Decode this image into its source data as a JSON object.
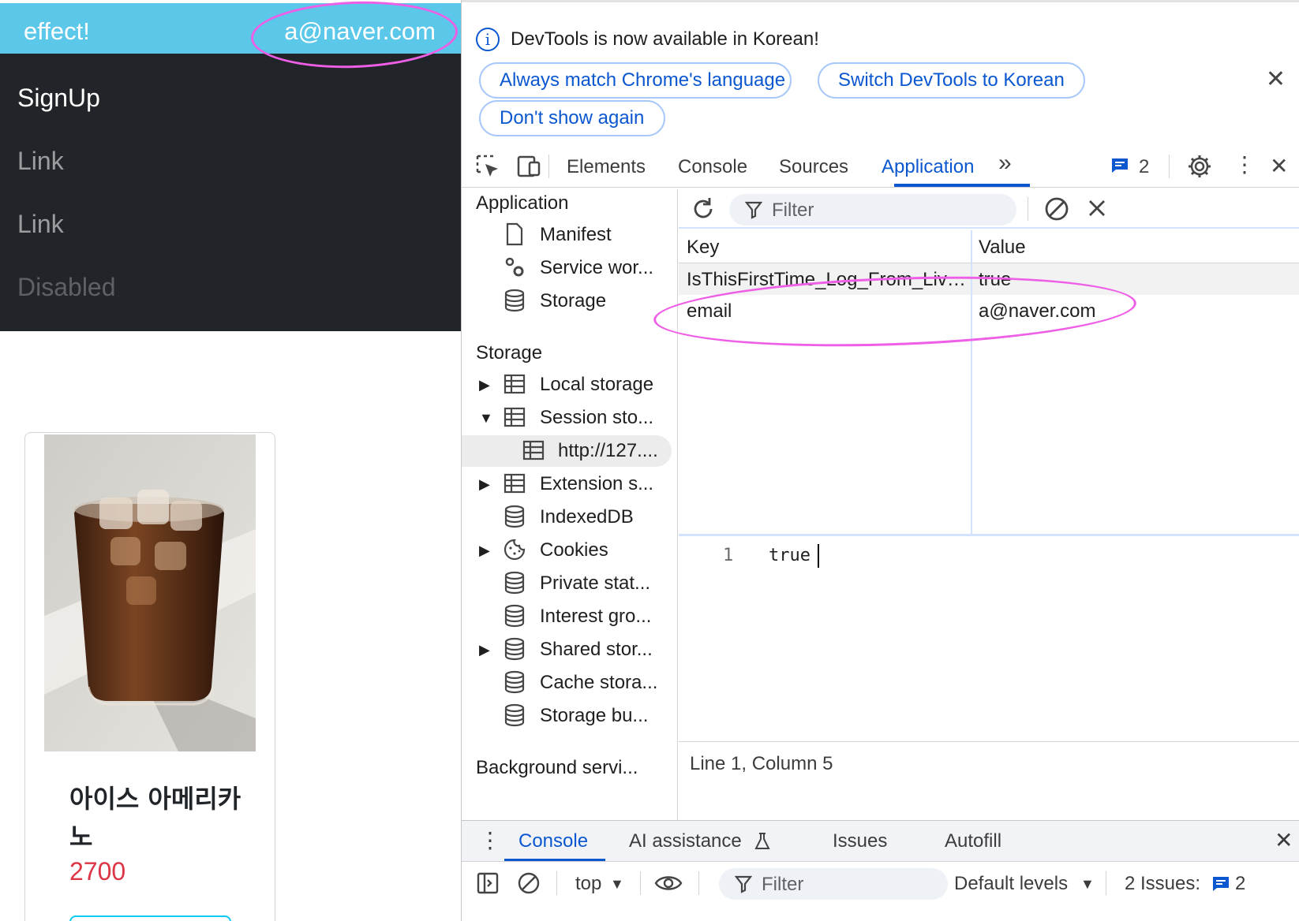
{
  "website": {
    "brand": "effect!",
    "user_email": "a@naver.com",
    "nav": {
      "signup": "SignUp",
      "link1": "Link",
      "link2": "Link",
      "disabled": "Disabled"
    },
    "product": {
      "name": "아이스 아메리카노",
      "price": "2700"
    }
  },
  "devtools": {
    "infobar": {
      "message": "DevTools is now available in Korean!",
      "btn_match": "Always match Chrome's language",
      "btn_switch": "Switch DevTools to Korean",
      "btn_dont_show": "Don't show again"
    },
    "tabs": {
      "elements": "Elements",
      "console": "Console",
      "sources": "Sources",
      "application": "Application",
      "issues_count": "2"
    },
    "sidebar": {
      "application_heading": "Application",
      "storage_heading": "Storage",
      "background_heading": "Background servi...",
      "items": [
        {
          "label": "Manifest",
          "icon": "document-icon"
        },
        {
          "label": "Service wor...",
          "icon": "gears-icon"
        },
        {
          "label": "Storage",
          "icon": "database-icon"
        },
        {
          "label": "Local storage",
          "icon": "table-icon"
        },
        {
          "label": "Session sto...",
          "icon": "table-icon"
        },
        {
          "label": "http://127....",
          "icon": "table-icon"
        },
        {
          "label": "Extension s...",
          "icon": "table-icon"
        },
        {
          "label": "IndexedDB",
          "icon": "database-icon"
        },
        {
          "label": "Cookies",
          "icon": "cookie-icon"
        },
        {
          "label": "Private stat...",
          "icon": "database-icon"
        },
        {
          "label": "Interest gro...",
          "icon": "database-icon"
        },
        {
          "label": "Shared stor...",
          "icon": "database-icon"
        },
        {
          "label": "Cache stora...",
          "icon": "database-icon"
        },
        {
          "label": "Storage bu...",
          "icon": "database-icon"
        }
      ]
    },
    "storage_view": {
      "filter_placeholder": "Filter",
      "columns": {
        "key": "Key",
        "value": "Value"
      },
      "rows": [
        {
          "key": "IsThisFirstTime_Log_From_LiveServer",
          "value": "true"
        },
        {
          "key": "email",
          "value": "a@naver.com"
        }
      ],
      "editor": {
        "line_number": "1",
        "line_text": "true"
      },
      "status": "Line 1, Column 5"
    },
    "drawer": {
      "tabs": {
        "console": "Console",
        "ai_assistance": "AI assistance",
        "issues": "Issues",
        "autofill": "Autofill"
      },
      "context": "top",
      "filter_placeholder": "Filter",
      "levels": "Default levels",
      "issues_label": "2 Issues:",
      "issues_count": "2"
    }
  },
  "colors": {
    "header_bg": "#5bc8ea",
    "nav_bg": "#212529",
    "price": "#dc3545",
    "devtools_accent": "#0b57d0",
    "annotation": "#ee5ee6"
  }
}
